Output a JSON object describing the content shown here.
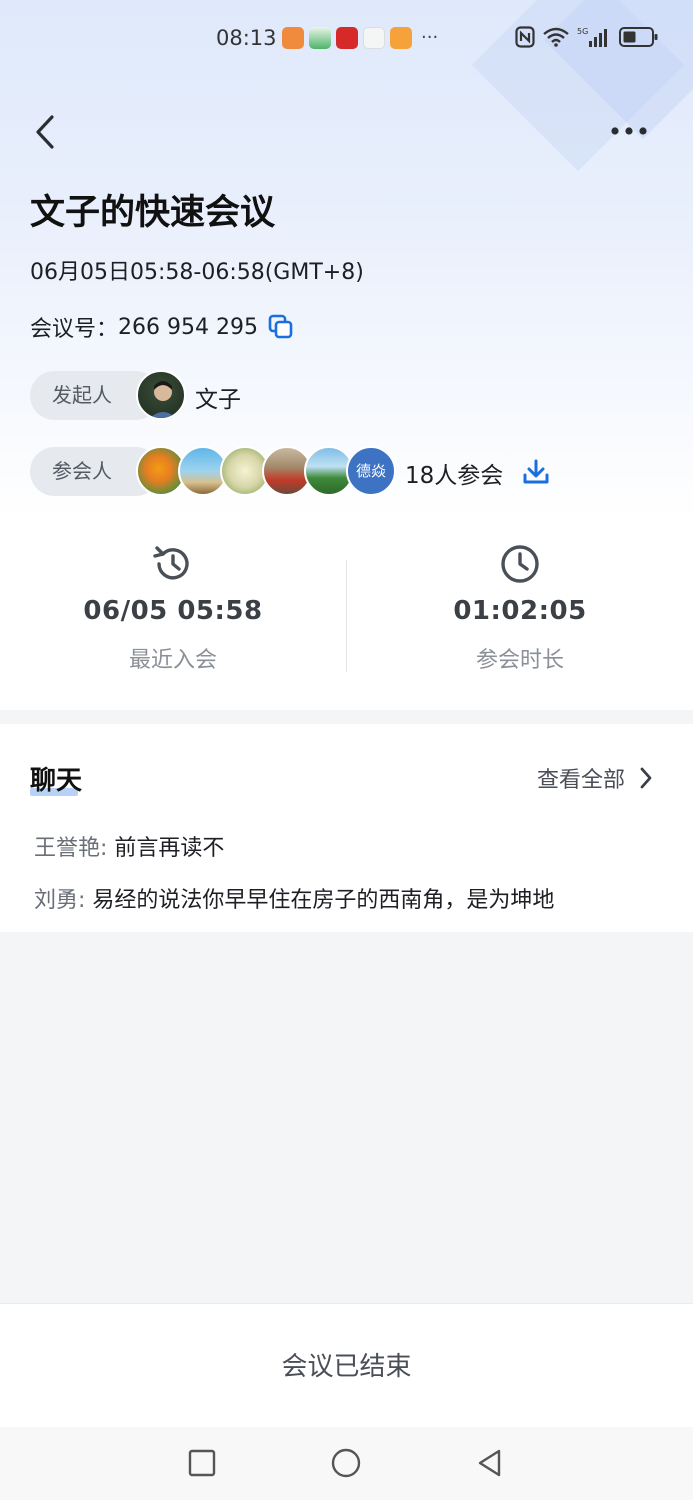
{
  "status_bar": {
    "time": "08:13",
    "more": "···",
    "app_icons": [
      "shield-app-icon",
      "gift-app-icon",
      "red-app-icon",
      "chat-bubble-app-icon",
      "orange-app-icon"
    ],
    "right_icons": [
      "nfc-icon",
      "wifi-icon",
      "signal-5g-icon",
      "battery-icon"
    ]
  },
  "meeting": {
    "title": "文子的快速会议",
    "time_range": "06月05日05:58-06:58(GMT+8)",
    "id_label": "会议号：",
    "id_value": "266 954 295"
  },
  "initiator": {
    "label": "发起人",
    "name": "文子"
  },
  "participants": {
    "label": "参会人",
    "text_avatar": "德焱",
    "count_text": "18人参会"
  },
  "stats": {
    "recent_join_value": "06/05 05:58",
    "recent_join_label": "最近入会",
    "duration_value": "01:02:05",
    "duration_label": "参会时长"
  },
  "chat": {
    "title": "聊天",
    "view_all": "查看全部",
    "messages": [
      {
        "name": "王誉艳: ",
        "text": "前言再读不"
      },
      {
        "name": "刘勇: ",
        "text": "易经的说法你早早住在房子的西南角，是为坤地"
      }
    ]
  },
  "footer": {
    "ended": "会议已结束"
  },
  "colors": {
    "accent": "#1a6fe0",
    "header_gradient_top": "#dfe9fb",
    "page_bg": "#f4f5f7"
  }
}
